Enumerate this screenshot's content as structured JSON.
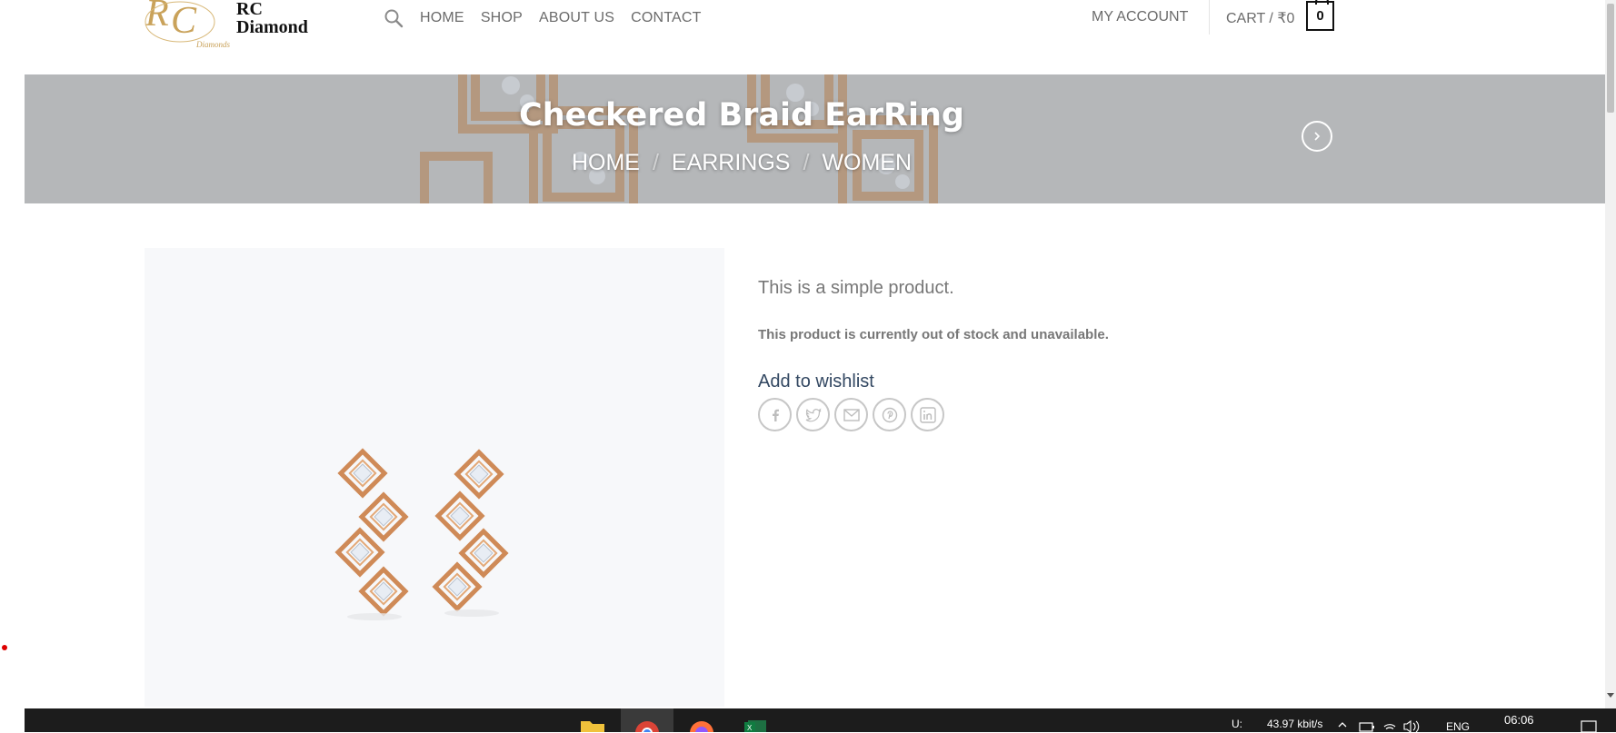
{
  "header": {
    "logo_line1": "RC",
    "logo_line2": "Diamond",
    "logo_script": "Diamonds",
    "nav": [
      "HOME",
      "SHOP",
      "ABOUT US",
      "CONTACT"
    ],
    "account_label": "MY ACCOUNT",
    "cart_label": "CART / ₹0",
    "cart_count": "0"
  },
  "banner": {
    "title": "Checkered Braid EarRing",
    "breadcrumb": [
      "HOME",
      "EARRINGS",
      "WOMEN"
    ],
    "separator": "/"
  },
  "product": {
    "short_description": "This is a simple product.",
    "stock_status": "This product is currently out of stock and unavailable.",
    "wishlist_label": "Add to wishlist",
    "share_icons": [
      "facebook-icon",
      "twitter-icon",
      "email-icon",
      "pinterest-icon",
      "linkedin-icon"
    ]
  },
  "taskbar": {
    "network_label": "U:",
    "network_speed": "43.97 kbit/s",
    "language": "ENG",
    "clock": "06:06"
  },
  "colors": {
    "banner_overlay": "#b4b6b9",
    "link": "#334862",
    "text": "#777777",
    "gold": "#c9a25a",
    "rose_gold": "#d08a57"
  }
}
